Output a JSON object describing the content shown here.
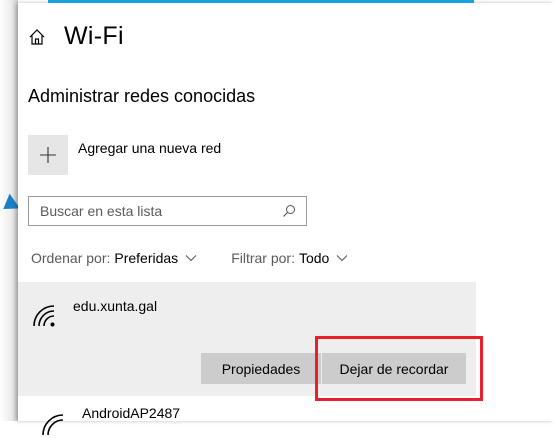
{
  "colors": {
    "accent": "#1a9fe0",
    "highlight": "#e8202a",
    "panel": "#eeeeee",
    "button": "#cccccc"
  },
  "header": {
    "title": "Wi-Fi",
    "icon": "home-icon"
  },
  "section": {
    "title": "Administrar redes conocidas"
  },
  "add_network": {
    "icon": "plus-icon",
    "label": "Agregar una nueva red"
  },
  "search": {
    "placeholder": "Buscar en esta lista",
    "icon": "search-icon"
  },
  "sort": {
    "label": "Ordenar por:",
    "value": "Preferidas"
  },
  "filter": {
    "label": "Filtrar por:",
    "value": "Todo"
  },
  "networks": [
    {
      "name": "edu.xunta.gal",
      "icon": "wifi-signal-icon",
      "selected": true,
      "buttons": {
        "properties": "Propiedades",
        "forget": "Dejar de recordar"
      }
    },
    {
      "name": "AndroidAP2487",
      "icon": "wifi-signal-icon"
    }
  ]
}
